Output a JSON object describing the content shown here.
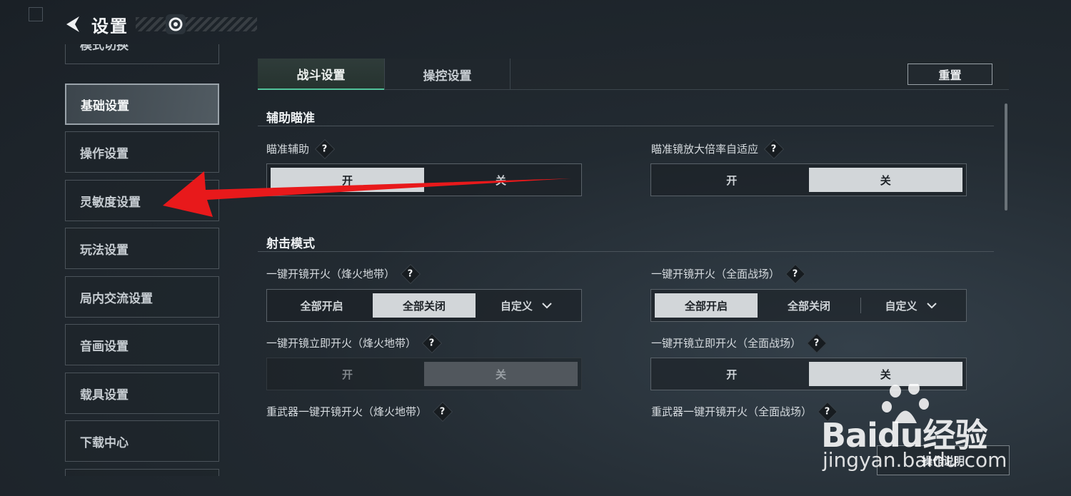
{
  "header": {
    "title": "设置"
  },
  "sidebar": {
    "items": [
      {
        "label": "模式切换"
      },
      {
        "label": "基础设置"
      },
      {
        "label": "操作设置"
      },
      {
        "label": "灵敏度设置"
      },
      {
        "label": "玩法设置"
      },
      {
        "label": "局内交流设置"
      },
      {
        "label": "音画设置"
      },
      {
        "label": "载具设置"
      },
      {
        "label": "下载中心"
      }
    ],
    "active_index": 1
  },
  "tabs": [
    {
      "label": "战斗设置"
    },
    {
      "label": "操控设置"
    }
  ],
  "reset_label": "重置",
  "sections": {
    "aim": {
      "title": "辅助瞄准"
    },
    "fire": {
      "title": "射击模式"
    }
  },
  "options": {
    "aim_assist": {
      "label": "瞄准辅助",
      "on": "开",
      "off": "关",
      "selected": "开"
    },
    "scope_adapt": {
      "label": "瞄准镜放大倍率自适应",
      "on": "开",
      "off": "关",
      "selected": "关"
    },
    "scope_fire_beacon": {
      "label": "一键开镜开火（烽火地带）",
      "all_on": "全部开启",
      "all_off": "全部关闭",
      "custom": "自定义",
      "selected": "全部关闭"
    },
    "scope_fire_battlefield": {
      "label": "一键开镜开火（全面战场）",
      "all_on": "全部开启",
      "all_off": "全部关闭",
      "custom": "自定义",
      "selected": "全部开启"
    },
    "instant_fire_beacon": {
      "label": "一键开镜立即开火（烽火地带）",
      "on": "开",
      "off": "关",
      "selected": "关"
    },
    "instant_fire_battlefield": {
      "label": "一键开镜立即开火（全面战场）",
      "on": "开",
      "off": "关",
      "selected": "关"
    },
    "heavy_fire_beacon": {
      "label": "重武器一键开镜开火（烽火地带）"
    },
    "heavy_fire_battlefield": {
      "label": "重武器一键开镜开火（全面战场）"
    }
  },
  "help_mark": "?",
  "bottom_button": {
    "label": "操作说明"
  },
  "watermark": {
    "brand": "Baidu经验",
    "url": "jingyan.baidu.com"
  },
  "colors": {
    "accent": "#52c49b",
    "arrow": "#e8191b"
  }
}
